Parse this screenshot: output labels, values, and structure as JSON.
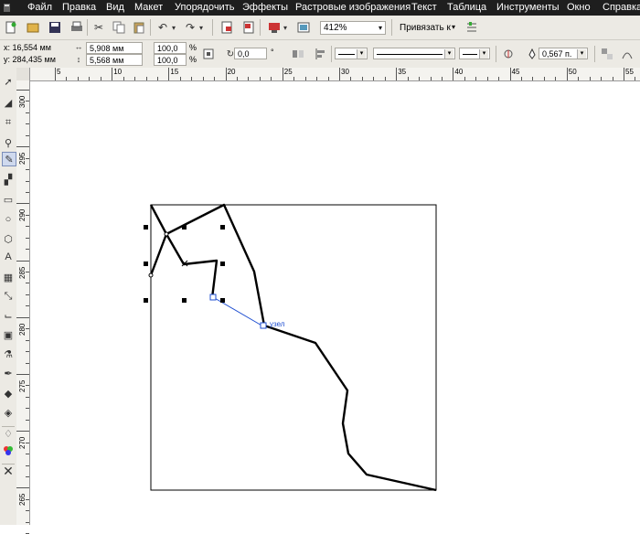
{
  "menu": {
    "items": [
      "Файл",
      "Правка",
      "Вид",
      "Макет",
      "Упорядочить",
      "Эффекты",
      "Растровые изображения",
      "Текст",
      "Таблица",
      "Инструменты",
      "Окно",
      "Справка"
    ]
  },
  "toolbar": {
    "zoom": "412%",
    "snap_label": "Привязать к"
  },
  "properties": {
    "x": "x:  16,554 мм",
    "y": "y:  284,435 мм",
    "width": "5,908 мм",
    "height": "5,568 мм",
    "scale_x": "100,0",
    "scale_y": "100,0",
    "percent": "%",
    "angle": "0,0",
    "degree": "°",
    "outline_width": "0,567 п."
  },
  "ruler_h": {
    "labels": [
      "5",
      "10",
      "15",
      "20",
      "25",
      "30",
      "35",
      "40",
      "45",
      "50",
      "55"
    ]
  },
  "ruler_v": {
    "labels": [
      "300",
      "295",
      "290",
      "285",
      "280",
      "275",
      "270",
      "265"
    ]
  },
  "canvas": {
    "node_label": "узел"
  },
  "toolbox": {
    "tools": [
      "pick-tool-icon",
      "shape-tool-icon",
      "crop-tool-icon",
      "zoom-tool-icon",
      "freehand-tool-icon",
      "smart-fill-icon",
      "rectangle-tool-icon",
      "ellipse-tool-icon",
      "polygon-tool-icon",
      "text-tool-icon",
      "table-tool-icon",
      "dimension-tool-icon",
      "connector-tool-icon",
      "blend-tool-icon",
      "eyedropper-tool-icon",
      "outline-tool-icon",
      "fill-tool-icon",
      "interactive-fill-icon",
      "pen-icon",
      "color-icon",
      "close-icon"
    ]
  },
  "colors": {
    "menubar": "#1e1e1e",
    "toolbar": "#eceae4",
    "node_highlight": "#1f4fd1"
  }
}
